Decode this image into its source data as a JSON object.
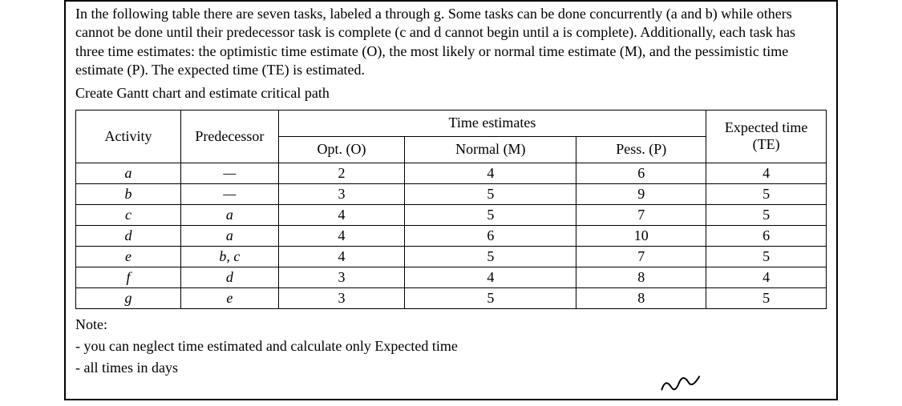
{
  "intro": "In the following table there are seven tasks, labeled a through g. Some tasks can be done concurrently (a and b) while others cannot be done until their predecessor task is complete (c and d cannot begin until a is complete). Additionally, each task has three time estimates: the optimistic time estimate (O), the most likely or normal time estimate (M), and the pessimistic time estimate (P). The expected time (TE) is estimated.",
  "instruction": "Create Gantt chart and estimate critical path",
  "headers": {
    "activity": "Activity",
    "predecessor": "Predecessor",
    "time_estimates": "Time estimates",
    "opt": "Opt. (O)",
    "normal": "Normal (M)",
    "pess": "Pess. (P)",
    "te": "Expected time (TE)"
  },
  "rows": [
    {
      "activity": "a",
      "predecessor": "—",
      "opt": "2",
      "normal": "4",
      "pess": "6",
      "te": "4"
    },
    {
      "activity": "b",
      "predecessor": "—",
      "opt": "3",
      "normal": "5",
      "pess": "9",
      "te": "5"
    },
    {
      "activity": "c",
      "predecessor": "a",
      "opt": "4",
      "normal": "5",
      "pess": "7",
      "te": "5"
    },
    {
      "activity": "d",
      "predecessor": "a",
      "opt": "4",
      "normal": "6",
      "pess": "10",
      "te": "6"
    },
    {
      "activity": "e",
      "predecessor": "b, c",
      "opt": "4",
      "normal": "5",
      "pess": "7",
      "te": "5"
    },
    {
      "activity": "f",
      "predecessor": "d",
      "opt": "3",
      "normal": "4",
      "pess": "8",
      "te": "4"
    },
    {
      "activity": "g",
      "predecessor": "e",
      "opt": "3",
      "normal": "5",
      "pess": "8",
      "te": "5"
    }
  ],
  "note": {
    "heading": "Note:",
    "line1": "- you can neglect time estimated and calculate only Expected time",
    "line2": "- all times in days"
  }
}
